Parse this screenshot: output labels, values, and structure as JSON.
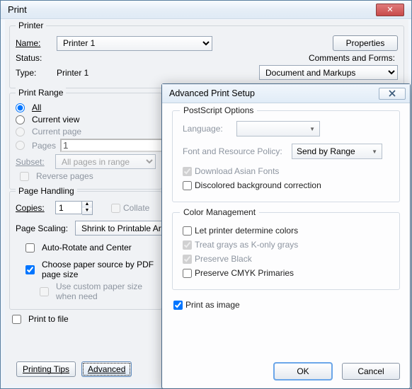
{
  "window": {
    "title": "Print"
  },
  "printer": {
    "group": "Printer",
    "name_label": "Name:",
    "name_value": "Printer 1",
    "status_label": "Status:",
    "type_label": "Type:",
    "type_value": "Printer 1",
    "properties_btn": "Properties",
    "comments_label": "Comments and Forms:",
    "comments_value": "Document and Markups"
  },
  "range": {
    "group": "Print Range",
    "all": "All",
    "current_view": "Current view",
    "current_page": "Current page",
    "pages": "Pages",
    "pages_value": "1",
    "subset_label": "Subset:",
    "subset_value": "All pages in range",
    "reverse": "Reverse pages"
  },
  "handling": {
    "group": "Page Handling",
    "copies_label": "Copies:",
    "copies_value": "1",
    "collate": "Collate",
    "scaling_label": "Page Scaling:",
    "scaling_value": "Shrink to Printable Area",
    "auto_rotate": "Auto-Rotate and Center",
    "choose_paper": "Choose paper source by PDF page size",
    "custom_paper": "Use custom paper size when need"
  },
  "print_to_file": "Print to file",
  "bottom": {
    "tips": "Printing Tips",
    "advanced": "Advanced"
  },
  "advanced": {
    "title": "Advanced Print Setup",
    "ps_group": "PostScript Options",
    "language_label": "Language:",
    "frp_label": "Font and Resource Policy:",
    "frp_value": "Send by Range",
    "download_asian": "Download Asian Fonts",
    "discolored": "Discolored background correction",
    "cm_group": "Color Management",
    "let_printer": "Let printer determine colors",
    "konly": "Treat grays as K-only grays",
    "preserve_black": "Preserve Black",
    "preserve_cmyk": "Preserve CMYK Primaries",
    "print_as_image": "Print as image",
    "ok": "OK",
    "cancel": "Cancel"
  }
}
